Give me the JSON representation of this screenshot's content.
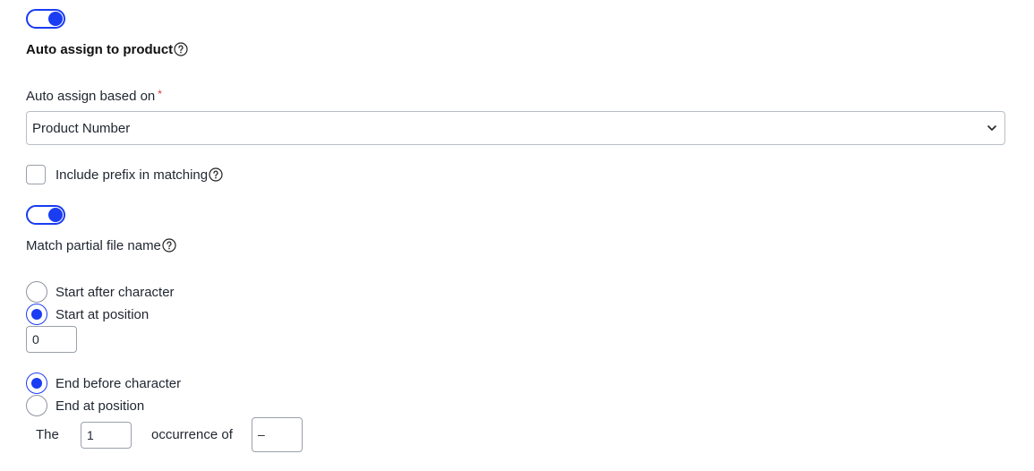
{
  "toggles": {
    "auto_assign": {
      "on": true
    },
    "match_partial": {
      "on": true
    }
  },
  "auto_assign": {
    "title": "Auto assign to product",
    "based_on_label": "Auto assign based on",
    "required_mark": "*",
    "selected_value": "Product Number"
  },
  "include_prefix": {
    "label": "Include prefix in matching",
    "checked": false
  },
  "match_partial": {
    "label": "Match partial file name"
  },
  "start_options": [
    {
      "label": "Start after character",
      "checked": false
    },
    {
      "label": "Start at position",
      "checked": true
    }
  ],
  "start_position_value": "0",
  "end_options": [
    {
      "label": "End before character",
      "checked": true
    },
    {
      "label": "End at position",
      "checked": false
    }
  ],
  "occurrence": {
    "prefix": "The",
    "count_value": "1",
    "middle": "occurrence of",
    "character_value": "–"
  },
  "colors": {
    "accent": "#1a3cf2",
    "required": "#d9363e",
    "border": "#b9bec7"
  }
}
